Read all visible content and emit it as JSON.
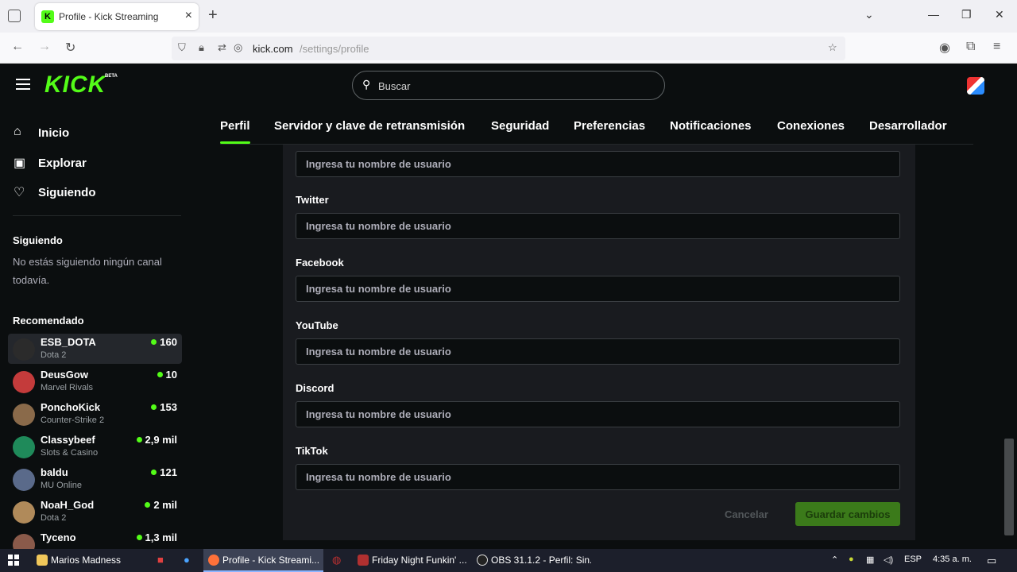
{
  "browser": {
    "tab_title": "Profile - Kick Streaming",
    "url_host": "kick.com",
    "url_path": "/settings/profile"
  },
  "header": {
    "logo_text": "KICK",
    "logo_sup": "BETA",
    "search_placeholder": "Buscar"
  },
  "sidebar": {
    "nav": [
      {
        "label": "Inicio",
        "icon": "home-icon"
      },
      {
        "label": "Explorar",
        "icon": "explore-icon"
      },
      {
        "label": "Siguiendo",
        "icon": "heart-icon"
      }
    ],
    "following_title": "Siguiendo",
    "following_empty": "No estás siguiendo ningún canal todavía.",
    "recommended_title": "Recomendado",
    "channels": [
      {
        "name": "ESB_DOTA",
        "category": "Dota 2",
        "viewers": "160",
        "avatar_color": "#2b2b2b"
      },
      {
        "name": "DeusGow",
        "category": "Marvel Rivals",
        "viewers": "10",
        "avatar_color": "#c43b3b"
      },
      {
        "name": "PonchoKick",
        "category": "Counter-Strike 2",
        "viewers": "153",
        "avatar_color": "#8a6a4a"
      },
      {
        "name": "Classybeef",
        "category": "Slots & Casino",
        "viewers": "2,9 mil",
        "avatar_color": "#1f8a5a"
      },
      {
        "name": "baldu",
        "category": "MU Online",
        "viewers": "121",
        "avatar_color": "#5a6a8a"
      },
      {
        "name": "NoaH_God",
        "category": "Dota 2",
        "viewers": "2 mil",
        "avatar_color": "#b08a5a"
      },
      {
        "name": "Tyceno",
        "category": "",
        "viewers": "1,3 mil",
        "avatar_color": "#8a5a4a"
      }
    ]
  },
  "tabs": [
    {
      "label": "Perfil",
      "active": true
    },
    {
      "label": "Servidor y clave de retransmisión",
      "active": false
    },
    {
      "label": "Seguridad",
      "active": false
    },
    {
      "label": "Preferencias",
      "active": false
    },
    {
      "label": "Notificaciones",
      "active": false
    },
    {
      "label": "Conexiones",
      "active": false
    },
    {
      "label": "Desarrollador",
      "active": false
    }
  ],
  "form": {
    "placeholder": "Ingresa tu nombre de usuario",
    "fields": [
      {
        "label": "Twitter"
      },
      {
        "label": "Facebook"
      },
      {
        "label": "YouTube"
      },
      {
        "label": "Discord"
      },
      {
        "label": "TikTok"
      }
    ],
    "cancel_label": "Cancelar",
    "save_label": "Guardar cambios"
  },
  "taskbar": {
    "items": [
      {
        "label": "Marios Madness",
        "icon_color": "#f0c75a"
      },
      {
        "label": "Profile - Kick Streami...",
        "icon_color": "#ff7139"
      },
      {
        "label": "Friday Night Funkin' ...",
        "icon_color": "#b03030"
      },
      {
        "label": "OBS 31.1.2 - Perfil: Sin...",
        "icon_color": "#dddddd"
      }
    ],
    "lang": "ESP",
    "time": "4:35 a. m."
  }
}
